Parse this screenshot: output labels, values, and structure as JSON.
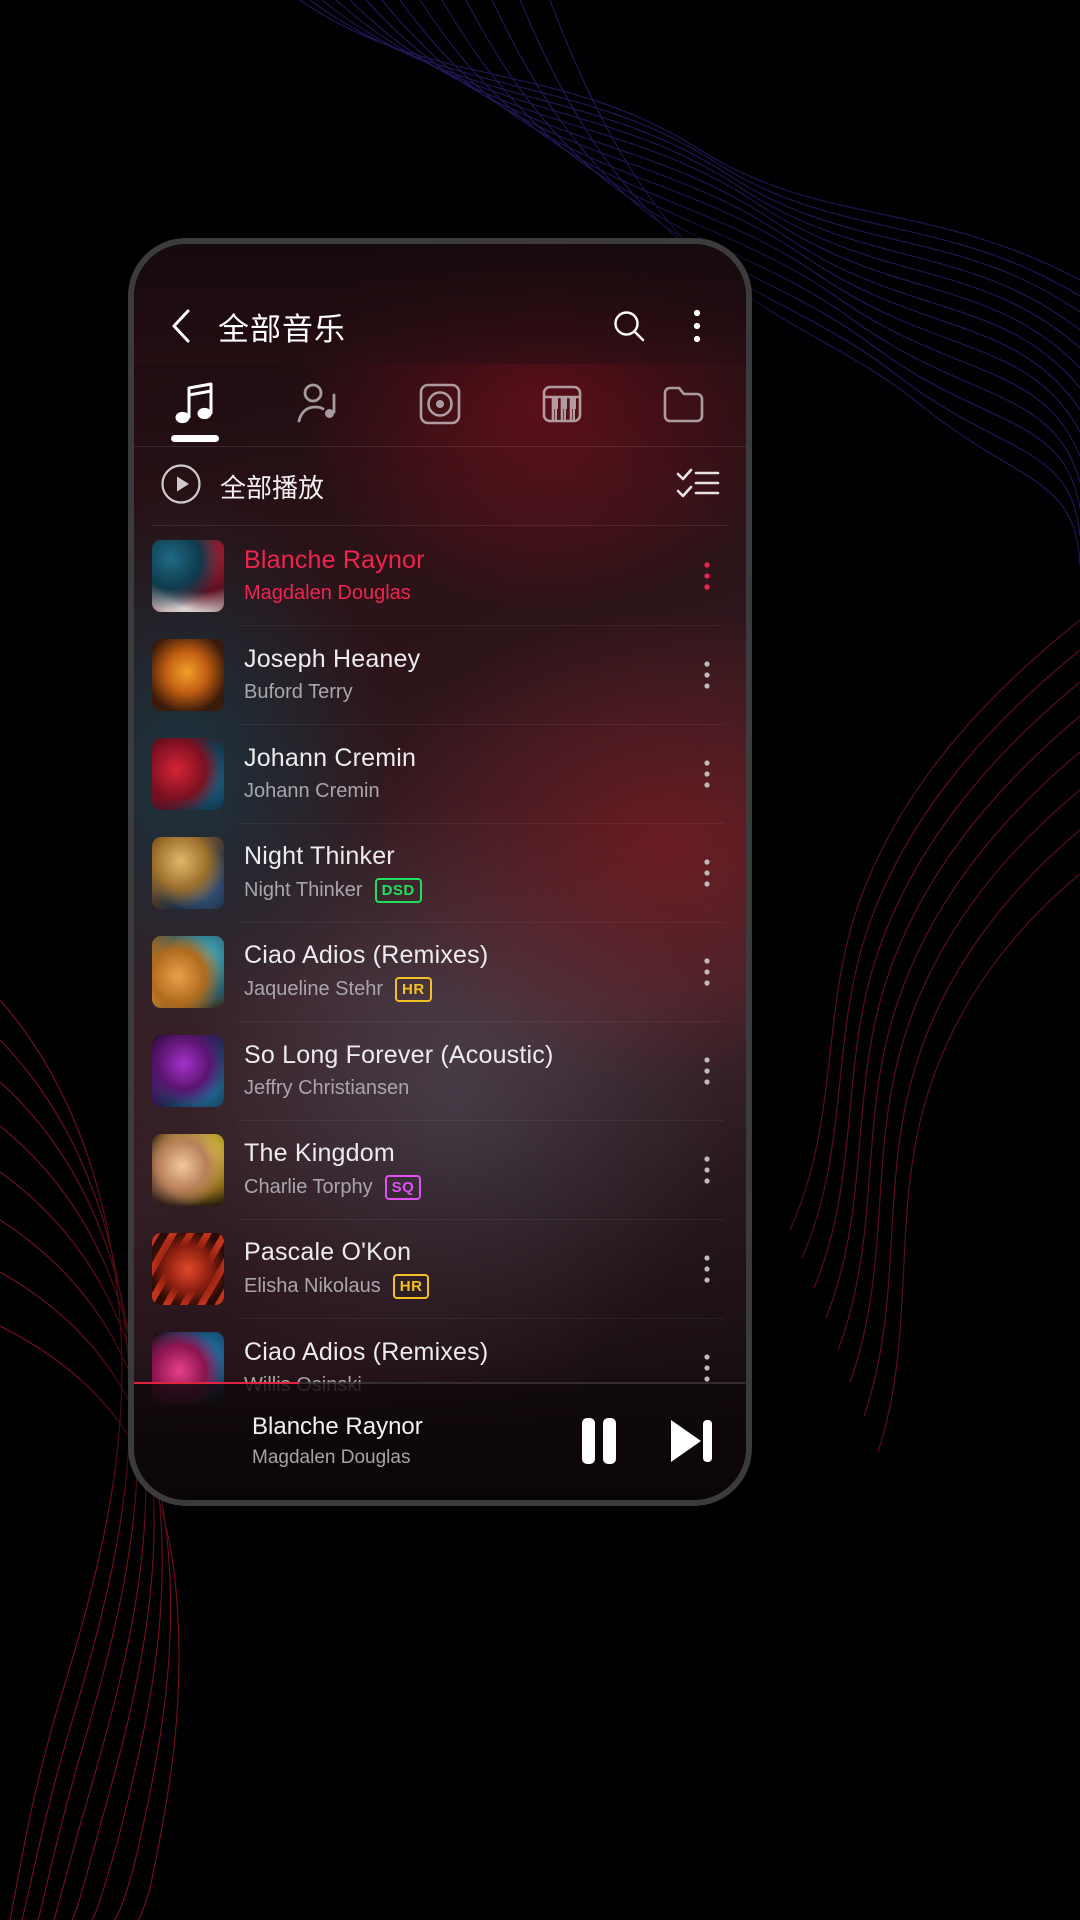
{
  "header": {
    "title": "全部音乐",
    "back_icon": "chevron-left-icon",
    "search_icon": "search-icon",
    "overflow_icon": "more-vertical-icon"
  },
  "tabs": [
    {
      "id": "songs",
      "icon": "music-note-icon",
      "active": true
    },
    {
      "id": "artists",
      "icon": "artist-icon",
      "active": false
    },
    {
      "id": "albums",
      "icon": "album-disc-icon",
      "active": false
    },
    {
      "id": "genres",
      "icon": "piano-keys-icon",
      "active": false
    },
    {
      "id": "folders",
      "icon": "folder-icon",
      "active": false
    }
  ],
  "playall": {
    "label": "全部播放",
    "play_icon": "play-circle-icon",
    "select_icon": "checklist-icon"
  },
  "songs": [
    {
      "title": "Blanche Raynor",
      "artist": "Magdalen Douglas",
      "badge": "",
      "playing": true,
      "art": "art-1"
    },
    {
      "title": "Joseph Heaney",
      "artist": "Buford Terry",
      "badge": "",
      "playing": false,
      "art": "art-2"
    },
    {
      "title": "Johann Cremin",
      "artist": "Johann Cremin",
      "badge": "",
      "playing": false,
      "art": "art-3"
    },
    {
      "title": "Night Thinker",
      "artist": "Night Thinker",
      "badge": "DSD",
      "playing": false,
      "art": "art-4"
    },
    {
      "title": "Ciao Adios (Remixes)",
      "artist": "Jaqueline Stehr",
      "badge": "HR",
      "playing": false,
      "art": "art-5"
    },
    {
      "title": "So Long Forever (Acoustic)",
      "artist": "Jeffry Christiansen",
      "badge": "",
      "playing": false,
      "art": "art-6"
    },
    {
      "title": "The Kingdom",
      "artist": "Charlie Torphy",
      "badge": "SQ",
      "playing": false,
      "art": "art-7"
    },
    {
      "title": "Pascale O'Kon",
      "artist": "Elisha Nikolaus",
      "badge": "HR",
      "playing": false,
      "art": "art-8"
    },
    {
      "title": "Ciao Adios (Remixes)",
      "artist": "Willis Osinski",
      "badge": "",
      "playing": false,
      "art": "art-9"
    }
  ],
  "row_menu_icon": "more-vertical-icon",
  "miniplayer": {
    "title": "Blanche Raynor",
    "artist": "Magdalen Douglas",
    "pause_icon": "pause-icon",
    "next_icon": "skip-next-icon",
    "progress_percent": 27
  },
  "colors": {
    "accent_playing": "#f0254f",
    "badge_dsd": "#1fe05a",
    "badge_hr": "#f2bf24",
    "badge_sq": "#e050f5",
    "progress_fill": "#e0243f",
    "text_primary": "#ececee",
    "text_secondary": "#a9a6ab"
  }
}
